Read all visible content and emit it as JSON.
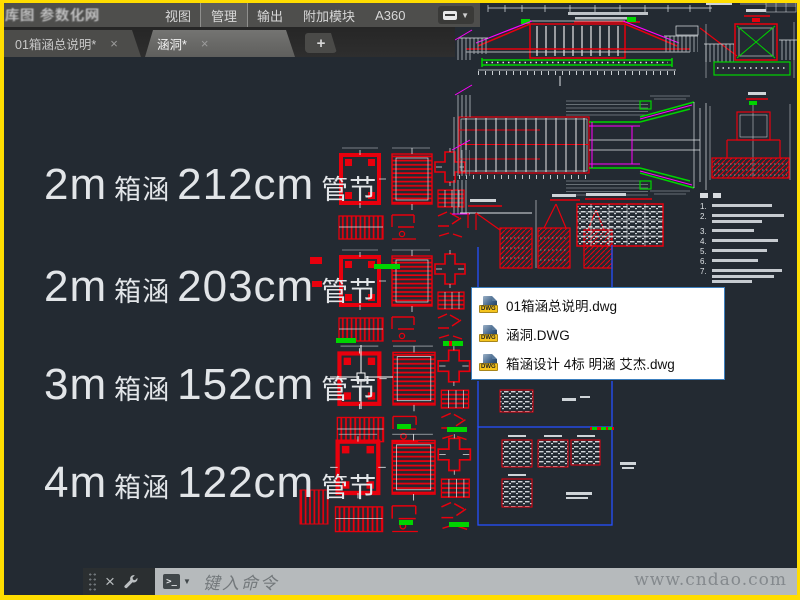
{
  "window": {
    "watermark_site": "www.cndao.com"
  },
  "menu_bar": {
    "watermark_overlay": "库图 参数化网",
    "items": [
      {
        "label": "视图",
        "active": false
      },
      {
        "label": "管理",
        "active": true
      },
      {
        "label": "输出",
        "active": false
      },
      {
        "label": "附加模块",
        "active": false
      },
      {
        "label": "A360",
        "active": false
      }
    ]
  },
  "tab_bar": {
    "tabs": [
      {
        "label": "01箱涵总说明*",
        "active": false,
        "close": "×"
      },
      {
        "label": "涵洞*",
        "active": true,
        "close": "×"
      }
    ],
    "new_tab_label": "+"
  },
  "drawing": {
    "size_labels": [
      {
        "prefix": "2m",
        "type": "箱涵",
        "dim": "212cm",
        "suffix": "管节"
      },
      {
        "prefix": "2m",
        "type": "箱涵",
        "dim": "203cm",
        "suffix": "管节"
      },
      {
        "prefix": "3m",
        "type": "箱涵",
        "dim": "152cm",
        "suffix": "管节"
      },
      {
        "prefix": "4m",
        "type": "箱涵",
        "dim": "122cm",
        "suffix": "管节"
      }
    ],
    "notes_numbers": [
      "1.",
      "2.",
      "3.",
      "4.",
      "5.",
      "6.",
      "7."
    ],
    "colors": {
      "line_red": "#e8000d",
      "line_green": "#00d400",
      "line_magenta": "#ff00ff",
      "line_white": "#e8e8e8",
      "viewport_blue": "#2650ff",
      "hatch_gray": "#9aa0a6"
    }
  },
  "file_popup": {
    "dwg_icon_label": "DWG",
    "files": [
      {
        "name": "01箱涵总说明.dwg"
      },
      {
        "name": "涵洞.DWG"
      },
      {
        "name": "箱涵设计 4标 明涵 艾杰.dwg"
      }
    ]
  },
  "command_bar": {
    "close_icon": "×",
    "prompt_icon": ">_",
    "dropdown_icon": "▼",
    "placeholder": "键入命令"
  }
}
